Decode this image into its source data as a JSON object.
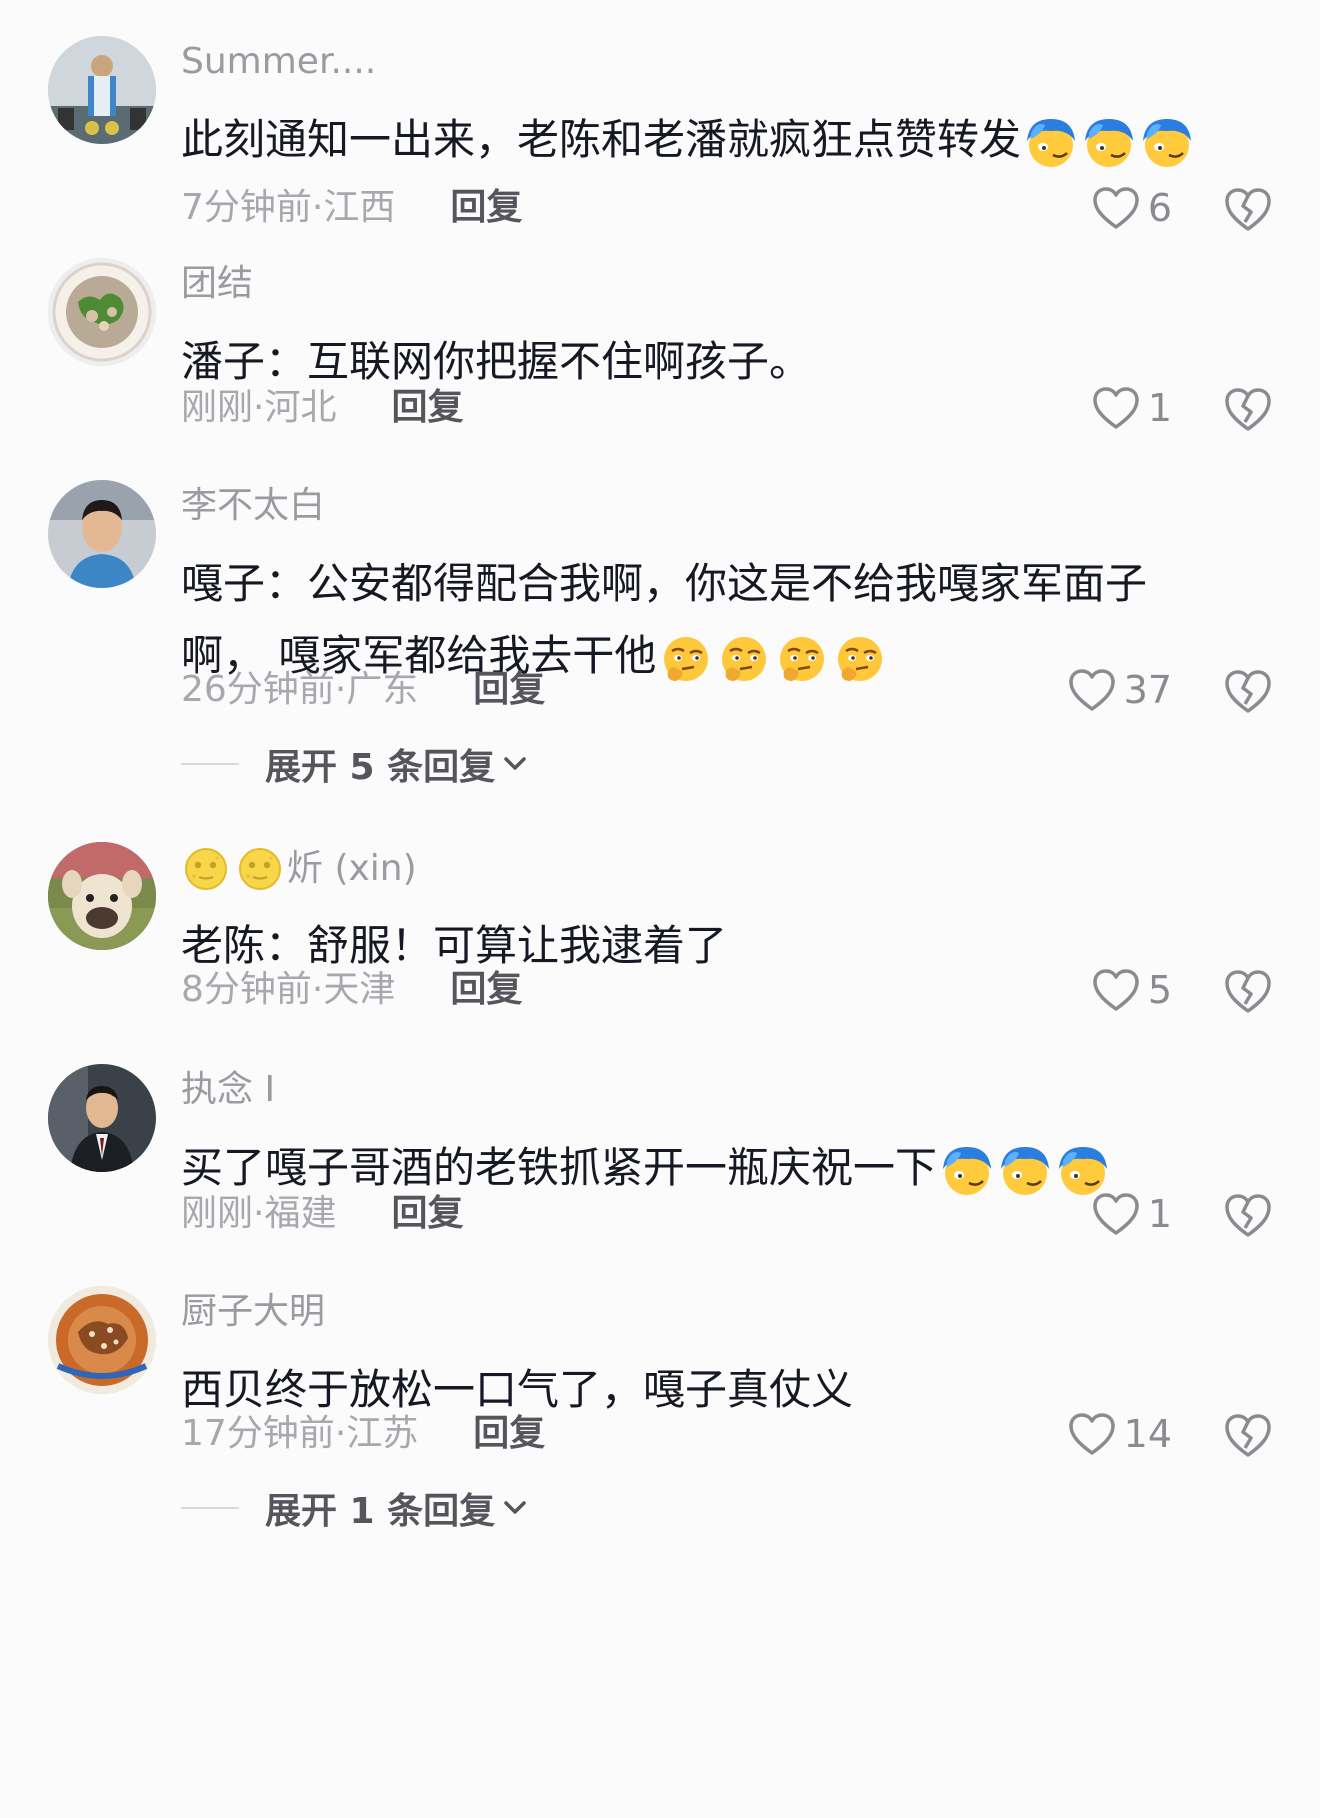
{
  "comments": [
    {
      "name": "Summer....",
      "text": "此刻通知一出来，老陈和老潘就疯狂点赞转发",
      "time": "7分钟前",
      "location": "江西",
      "reply_label": "回复",
      "likes": "6",
      "trailing_emoji": "smirk-blue-hair",
      "emoji_count": 3
    },
    {
      "name": "团结",
      "text": "潘子：互联网你把握不住啊孩子。",
      "time": "刚刚",
      "location": "河北",
      "reply_label": "回复",
      "likes": "1"
    },
    {
      "name": "李不太白",
      "text": "嘎子：公安都得配合我啊，你这是不给我嘎家军面子啊， 嘎家军都给我去干他",
      "time": "26分钟前",
      "location": "广东",
      "reply_label": "回复",
      "likes": "37",
      "trailing_emoji": "thinking-face",
      "emoji_count": 4,
      "expand_label": "展开 5 条回复"
    },
    {
      "name": "炘 (xin)",
      "name_prefix_emoji": "moon-face",
      "name_prefix_count": 2,
      "text": "老陈：舒服！可算让我逮着了",
      "time": "8分钟前",
      "location": "天津",
      "reply_label": "回复",
      "likes": "5"
    },
    {
      "name": "执念 I",
      "text": "买了嘎子哥酒的老铁抓紧开一瓶庆祝一下",
      "time": "刚刚",
      "location": "福建",
      "reply_label": "回复",
      "likes": "1",
      "trailing_emoji": "smirk-blue-hair",
      "emoji_count": 3
    },
    {
      "name": "厨子大明",
      "text": "西贝终于放松一口气了，嘎子真仗义",
      "time": "17分钟前",
      "location": "江苏",
      "reply_label": "回复",
      "likes": "14",
      "expand_label": "展开 1 条回复"
    }
  ],
  "icons": {
    "like": "heart-outline-icon",
    "dislike": "broken-heart-icon",
    "expand": "chevron-down-icon"
  },
  "colors": {
    "background": "#fbfbfb",
    "text": "#161823",
    "muted": "#a7a8ad",
    "name": "#9a9ba0"
  }
}
